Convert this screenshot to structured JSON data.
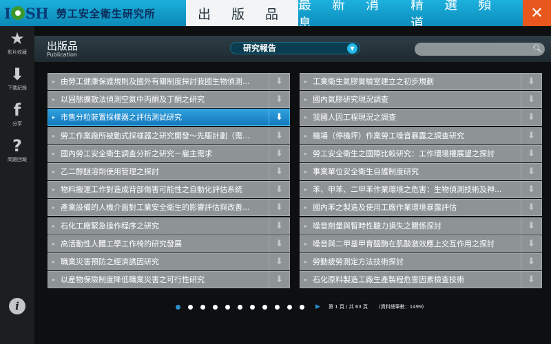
{
  "header": {
    "logo": "IOSH",
    "org_name": "勞工安全衛生研究所",
    "nav": [
      "出 版 品",
      "最 新 消 息",
      "精 選 頻 道"
    ],
    "close": "✕"
  },
  "sidebar": [
    {
      "icon": "star-icon",
      "glyph": "★",
      "label": "影片收藏"
    },
    {
      "icon": "download-icon",
      "glyph": "⬇",
      "label": "下載紀錄"
    },
    {
      "icon": "facebook-icon",
      "glyph": "f",
      "label": "分享"
    },
    {
      "icon": "question-icon",
      "glyph": "?",
      "label": "問題回報"
    }
  ],
  "info_glyph": "i",
  "page": {
    "title": "出版品",
    "subtitle": "Publication",
    "category": "研究報告",
    "search_placeholder": ""
  },
  "left_list": [
    "由勞工健康保護規則及國外有關制度探討我國生物偵測...",
    "以固態擴散法偵測空氣中丙酮及丁酮之研究",
    "市售分粒裝置採樣器之評估測試研究",
    "勞工作業廠所被動式採樣器之研究開發～先驅計劃（需...",
    "國內勞工安全衛生調查分析之研究－雇主需求",
    "乙二醇醚溶劑使用管理之探討",
    "物料搬運工作對造成背部傷害可能性之自動化評估系統",
    "產業設備的人機介面對工業安全衛生的影響評估與改善...",
    "石化工廠緊急操作程序之研究",
    "高活動性人體工學工作椅的研究發展",
    "職業災害預防之經濟誘因研究",
    "以産物保險制度降低職業災害之可行性研究"
  ],
  "right_list": [
    "工業衛生氣膠實驗室建立之初步規劃",
    "國內氣膠研究現況調查",
    "我國人因工程現況之調查",
    "機場（停機坪）作業勞工噪音暴露之調查研究",
    "勞工安全衛生之國際比較研究：工作環境權展望之探討",
    "事業單位安全衛生自護制度研究",
    "苯、甲苯、二甲苯作業環境之危害：生物偵測技術及神...",
    "國內苯之製造及使用工廠作業環境暴露評估",
    "噪音劑量與暫時性聽力損失之關係探討",
    "噪音與二甲基甲育醯酶在肌酸激效應上交互作用之探討",
    "勞動疲勞測定方法技術探討",
    "石化原料製造工廠生產製程危害因素檢查技術"
  ],
  "active_index_left": 2,
  "download_glyph": "⬇",
  "pagination": {
    "dot_count": 11,
    "current_dot": 0,
    "next": "▶",
    "page_info": "第 1 頁 / 共 63 頁",
    "total_info": "(資料總筆數：1499)"
  }
}
